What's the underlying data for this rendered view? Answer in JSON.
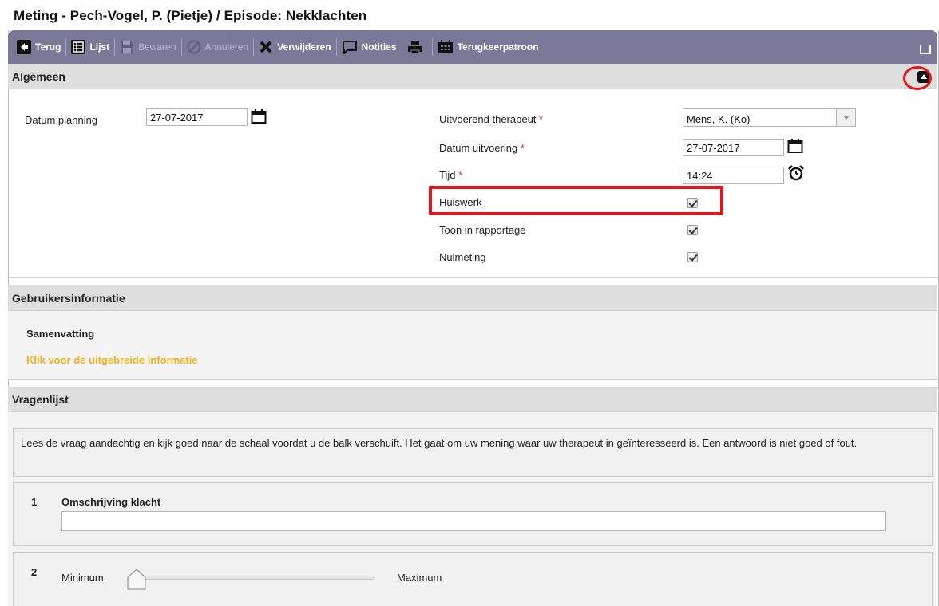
{
  "header": {
    "title": "Meting - Pech-Vogel, P. (Pietje) / Episode: Nekklachten"
  },
  "toolbar": {
    "back": "Terug",
    "list": "Lijst",
    "save": "Bewaren",
    "cancel": "Annuleren",
    "delete": "Verwijderen",
    "notes": "Notities",
    "recurrence": "Terugkeerpatroon",
    "colors": {
      "bar": "#7a7a98",
      "enabled_text": "#ffffff",
      "disabled_text": "#b8b8cc"
    }
  },
  "algemeen": {
    "title": "Algemeen",
    "datum_planning_label": "Datum planning",
    "datum_planning_value": "27-07-2017",
    "therapeut_label": "Uitvoerend therapeut",
    "therapeut_value": "Mens, K. (Ko)",
    "datum_uitvoering_label": "Datum uitvoering",
    "datum_uitvoering_value": "27-07-2017",
    "tijd_label": "Tijd",
    "tijd_value": "14:24",
    "required_mark": "*",
    "huiswerk_label": "Huiswerk",
    "huiswerk_checked": true,
    "rapportage_label": "Toon in rapportage",
    "rapportage_checked": true,
    "nulmeting_label": "Nulmeting",
    "nulmeting_checked": true
  },
  "gebruikersinformatie": {
    "title": "Gebruikersinformatie",
    "samenvatting": "Samenvatting",
    "link": "Klik voor de uitgebreide informatie",
    "link_color": "#f0b21c"
  },
  "vragenlijst": {
    "title": "Vragenlijst",
    "intro": "Lees de vraag aandachtig en kijk goed naar de schaal voordat u de balk verschuift. Het gaat om uw mening waar uw therapeut in geïnteresseerd is. Een antwoord is niet goed of fout.",
    "questions": [
      {
        "number": "1",
        "title": "Omschrijving klacht",
        "value": ""
      },
      {
        "number": "2",
        "min_label": "Minimum",
        "max_label": "Maximum",
        "slider_value": 0
      }
    ]
  },
  "annotations": {
    "highlight_color": "#e1151b"
  }
}
